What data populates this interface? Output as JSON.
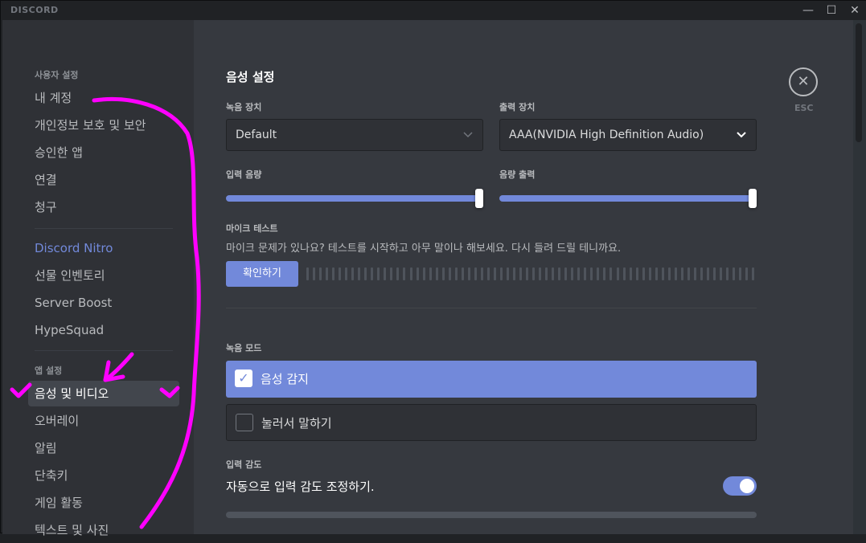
{
  "window": {
    "brand": "DISCORD",
    "controls": {
      "minimize": "—",
      "maximize": "☐",
      "close": "✕"
    }
  },
  "sidebar": {
    "user_settings_header": "사용자 설정",
    "user_items": [
      "내 계정",
      "개인정보 보호 및 보안",
      "승인한 앱",
      "연결",
      "청구"
    ],
    "nitro_items": [
      "Discord Nitro",
      "선물 인벤토리",
      "Server Boost",
      "HypeSquad"
    ],
    "app_settings_header": "앱 설정",
    "app_items": [
      "음성 및 비디오",
      "오버레이",
      "알림",
      "단축키",
      "게임 활동",
      "텍스트 및 사진"
    ],
    "selected_item": "음성 및 비디오"
  },
  "main": {
    "title": "음성 설정",
    "input_device": {
      "label": "녹음 장치",
      "value": "Default"
    },
    "output_device": {
      "label": "출력 장치",
      "value": "AAA(NVIDIA High Definition Audio)"
    },
    "input_volume": {
      "label": "입력 음량",
      "value_percent": 100
    },
    "output_volume": {
      "label": "음량 출력",
      "value_percent": 100
    },
    "mic_test": {
      "label": "마이크 테스트",
      "description": "마이크 문제가 있나요? 테스트를 시작하고 아무 말이나 해보세요. 다시 들려 드릴 테니까요.",
      "button": "확인하기"
    },
    "input_mode": {
      "label": "녹음 모드",
      "options": [
        {
          "label": "음성 감지",
          "checked": true
        },
        {
          "label": "눌러서 말하기",
          "checked": false
        }
      ]
    },
    "input_sensitivity": {
      "label": "입력 감도",
      "auto_text": "자동으로 입력 감도 조정하기.",
      "auto_enabled": true
    },
    "esc": {
      "icon": "close-icon",
      "label": "ESC"
    }
  },
  "colors": {
    "accent": "#7289da",
    "background": "#36393f",
    "sidebar": "#2f3136",
    "annotation": "#ff00ff"
  }
}
